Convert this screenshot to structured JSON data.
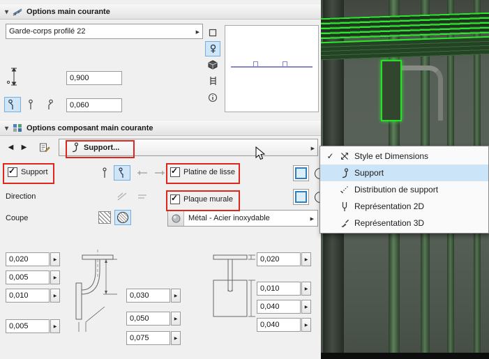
{
  "section_rail": {
    "title": "Options main courante",
    "profile_value": "Garde-corps profilé 22",
    "height_value": "0,900",
    "offset_value": "0,060"
  },
  "section_component": {
    "title": "Options composant main courante",
    "component_button": "Support...",
    "support_label": "Support",
    "platine_label": "Platine de lisse",
    "plaque_label": "Plaque murale",
    "direction_label": "Direction",
    "coupe_label": "Coupe",
    "material_value": "Métal - Acier inoxydable"
  },
  "dimensions": {
    "left": [
      "0,020",
      "0,005",
      "0,010",
      "0,005"
    ],
    "middle": [
      "0,030",
      "0,050",
      "0,075"
    ],
    "right": [
      "0,020",
      "0,010",
      "0,040",
      "0,040"
    ]
  },
  "popup": {
    "items": [
      {
        "label": "Style et Dimensions",
        "checked": true
      },
      {
        "label": "Support",
        "selected": true
      },
      {
        "label": "Distribution de support"
      },
      {
        "label": "Représentation 2D"
      },
      {
        "label": "Représentation 3D"
      }
    ]
  },
  "colors": {
    "annotation_red": "#e0261b",
    "selection_blue": "#cfe6f8",
    "popup_selection": "#cce4f7",
    "highlight_green": "#29df29",
    "preview_line_purple": "#8585d6"
  }
}
